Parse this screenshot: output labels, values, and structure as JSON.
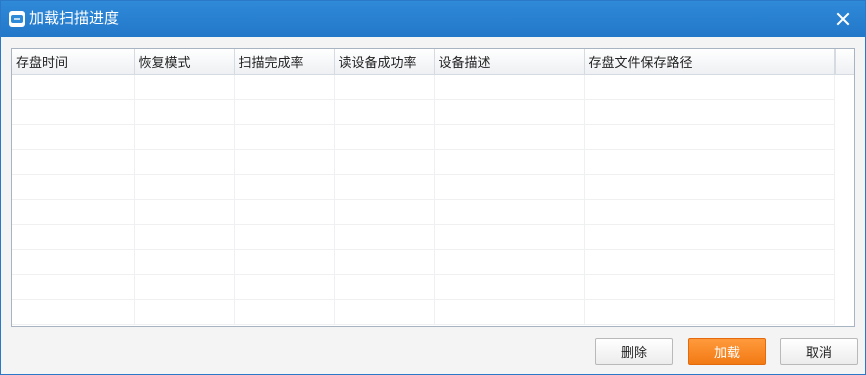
{
  "window": {
    "title": "加载扫描进度"
  },
  "table": {
    "columns": [
      "存盘时间",
      "恢复模式",
      "扫描完成率",
      "读设备成功率",
      "设备描述",
      "存盘文件保存路径"
    ],
    "rows": []
  },
  "buttons": {
    "delete_label": "删除",
    "load_label": "加载",
    "cancel_label": "取消"
  },
  "colors": {
    "titlebar": "#2377c9",
    "accent": "#f27a14"
  }
}
